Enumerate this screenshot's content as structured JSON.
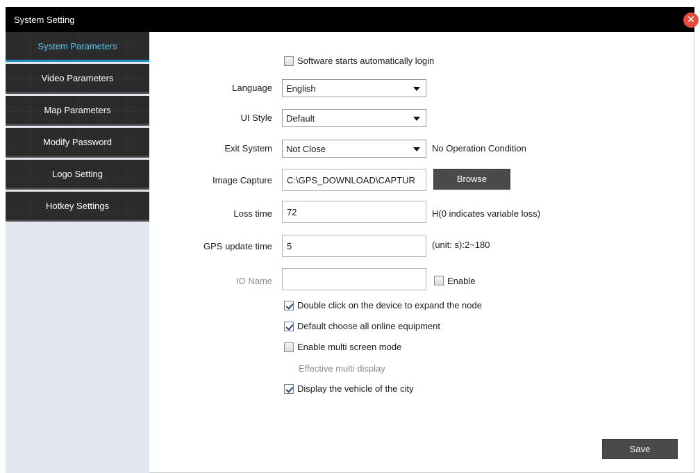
{
  "window": {
    "title": "System Setting"
  },
  "sidebar": {
    "items": [
      {
        "label": "System Parameters"
      },
      {
        "label": "Video Parameters"
      },
      {
        "label": "Map Parameters"
      },
      {
        "label": "Modify Password"
      },
      {
        "label": "Logo Setting"
      },
      {
        "label": "Hotkey Settings"
      }
    ]
  },
  "form": {
    "auto_login_label": "Software starts automatically login",
    "language": {
      "label": "Language",
      "value": "English"
    },
    "ui_style": {
      "label": "UI Style",
      "value": "Default"
    },
    "exit_system": {
      "label": "Exit System",
      "value": "Not Close",
      "hint": "No Operation Condition"
    },
    "image_capture": {
      "label": "Image Capture",
      "value": "C:\\GPS_DOWNLOAD\\CAPTUR",
      "browse_label": "Browse"
    },
    "loss_time": {
      "label": "Loss time",
      "value": "72",
      "hint": "H(0 indicates variable loss)"
    },
    "gps_update": {
      "label": "GPS update time",
      "value": "5",
      "hint": "(unit: s):2~180"
    },
    "io_name": {
      "label": "IO Name",
      "value": "",
      "enable_label": "Enable"
    },
    "double_click_label": "Double click on the device to expand the node",
    "default_choose_label": "Default choose all online equipment",
    "multi_screen_label": "Enable multi screen mode",
    "effective_display_label": "Effective multi display",
    "display_city_label": "Display the vehicle of the city",
    "save_label": "Save"
  },
  "state": {
    "auto_login": false,
    "io_enable": false,
    "double_click": true,
    "default_choose": true,
    "multi_screen": false,
    "display_city": true
  }
}
